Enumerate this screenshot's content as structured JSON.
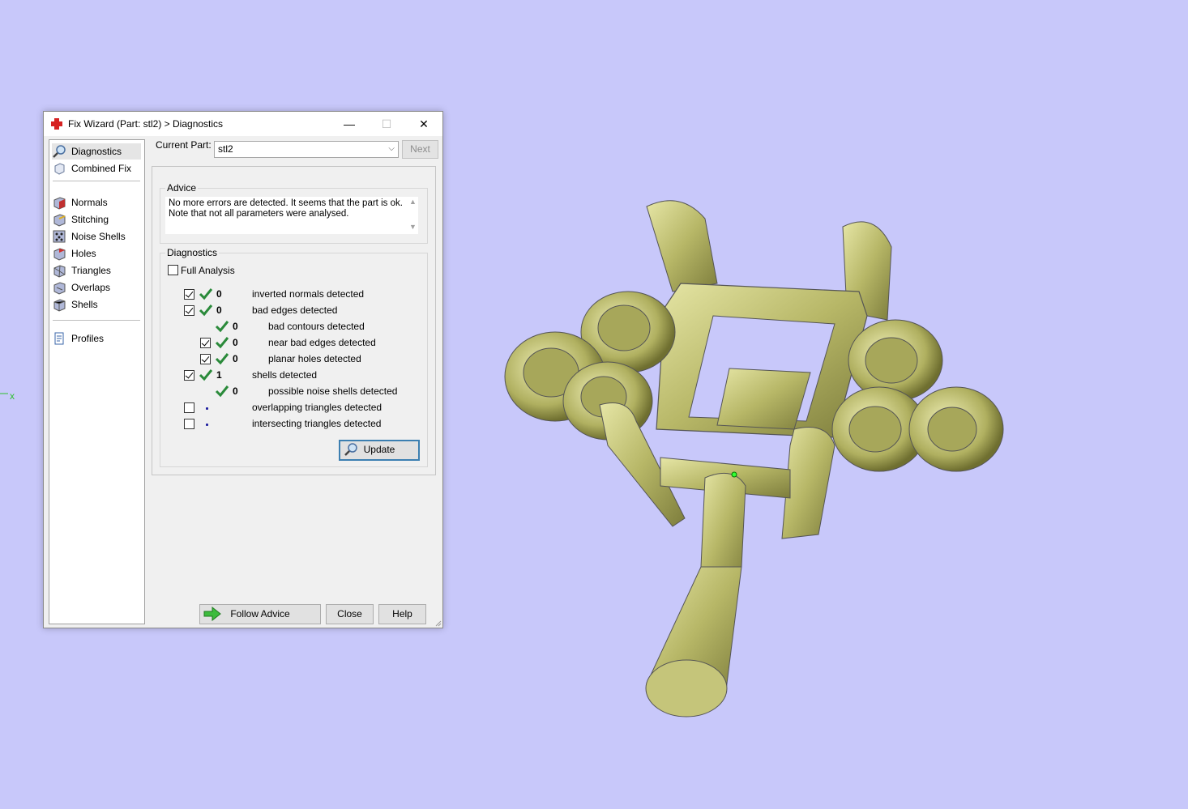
{
  "window": {
    "title": "Fix Wizard (Part: stl2) > Diagnostics",
    "min_glyph": "—",
    "max_glyph": "☐",
    "close_glyph": "✕"
  },
  "nav": {
    "items": [
      {
        "label": "Diagnostics",
        "icon": "magnifier-icon",
        "selected": true
      },
      {
        "label": "Combined Fix",
        "icon": "combined-fix-icon"
      },
      {
        "label": "Normals",
        "icon": "normals-icon"
      },
      {
        "label": "Stitching",
        "icon": "stitching-icon"
      },
      {
        "label": "Noise Shells",
        "icon": "noise-shells-icon"
      },
      {
        "label": "Holes",
        "icon": "holes-icon"
      },
      {
        "label": "Triangles",
        "icon": "triangles-icon"
      },
      {
        "label": "Overlaps",
        "icon": "overlaps-icon"
      },
      {
        "label": "Shells",
        "icon": "shells-icon"
      },
      {
        "label": "Profiles",
        "icon": "profiles-icon"
      }
    ]
  },
  "current_part": {
    "label": "Current Part:",
    "value": "stl2",
    "next_label": "Next"
  },
  "advice": {
    "legend": "Advice",
    "line1": "No more errors are detected. It seems that the part is ok.",
    "line2": "Note that not all parameters were analysed."
  },
  "diagnostics": {
    "legend": "Diagnostics",
    "full_analysis_label": "Full Analysis",
    "full_analysis_checked": false,
    "rows": [
      {
        "checked": true,
        "status": "ok",
        "count": "0",
        "label": "inverted normals detected"
      },
      {
        "checked": true,
        "status": "ok",
        "count": "0",
        "label": "bad edges detected"
      },
      {
        "checked": null,
        "status": "ok",
        "count": "0",
        "label": "bad contours detected"
      },
      {
        "checked": true,
        "status": "ok",
        "count": "0",
        "label": "near bad edges detected"
      },
      {
        "checked": true,
        "status": "ok",
        "count": "0",
        "label": "planar holes detected"
      },
      {
        "checked": true,
        "status": "ok",
        "count": "1",
        "label": "shells detected"
      },
      {
        "checked": null,
        "status": "ok",
        "count": "0",
        "label": "possible noise shells detected"
      },
      {
        "checked": false,
        "status": "not-analysed",
        "count": "",
        "label": "overlapping triangles detected"
      },
      {
        "checked": false,
        "status": "not-analysed",
        "count": "",
        "label": "intersecting triangles detected"
      }
    ],
    "update_label": "Update"
  },
  "footer": {
    "follow_advice_label": "Follow Advice",
    "close_label": "Close",
    "help_label": "Help"
  },
  "viewport": {
    "axis_label": "x",
    "background": "#c8c8fa",
    "model_color": "#c9c97a"
  }
}
